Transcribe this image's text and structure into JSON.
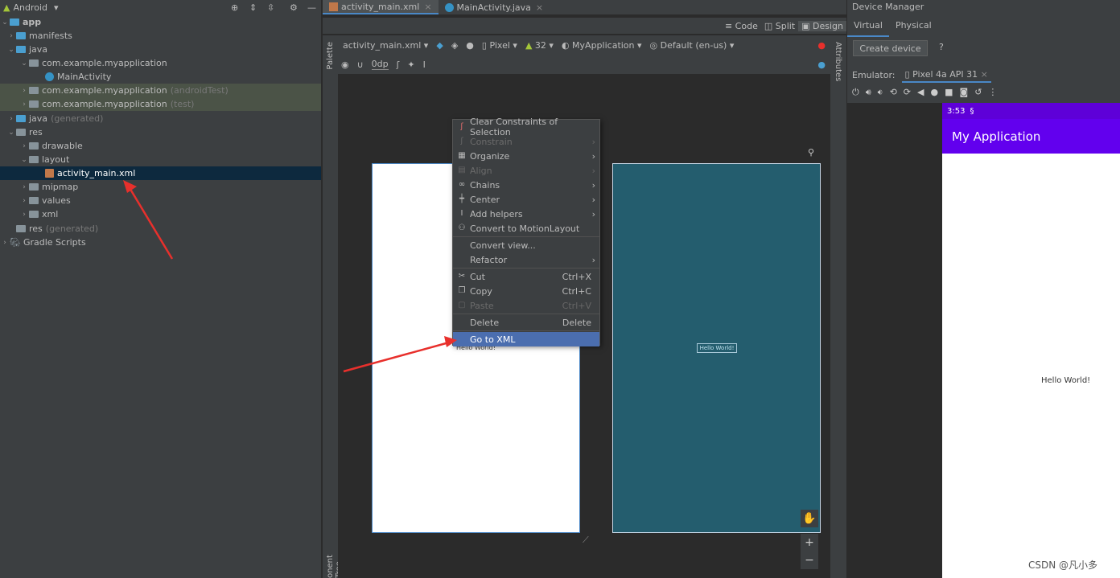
{
  "project": {
    "header": "Android",
    "tree": [
      {
        "label": "app",
        "note": ""
      },
      {
        "label": "manifests",
        "note": ""
      },
      {
        "label": "java",
        "note": ""
      },
      {
        "label": "com.example.myapplication",
        "note": ""
      },
      {
        "label": "MainActivity",
        "note": ""
      },
      {
        "label": "com.example.myapplication",
        "note": "(androidTest)"
      },
      {
        "label": "com.example.myapplication",
        "note": "(test)"
      },
      {
        "label": "java",
        "note": "(generated)"
      },
      {
        "label": "res",
        "note": ""
      },
      {
        "label": "drawable",
        "note": ""
      },
      {
        "label": "layout",
        "note": ""
      },
      {
        "label": "activity_main.xml",
        "note": ""
      },
      {
        "label": "mipmap",
        "note": ""
      },
      {
        "label": "values",
        "note": ""
      },
      {
        "label": "xml",
        "note": ""
      },
      {
        "label": "res",
        "note": "(generated)"
      },
      {
        "label": "Gradle Scripts",
        "note": ""
      }
    ]
  },
  "editor": {
    "tabs": [
      "activity_main.xml",
      "MainActivity.java"
    ],
    "modes": [
      "Code",
      "Split",
      "Design"
    ],
    "toolbar": {
      "file": "activity_main.xml",
      "device": "Pixel",
      "api": "32",
      "theme": "MyApplication",
      "locale": "Default (en-us)",
      "margin": "0dp"
    },
    "palette_label": "Palette",
    "attributes_label": "Attributes",
    "component_tree_label": "onent Tree",
    "hello_text": "Hello World!"
  },
  "context_menu": {
    "items": [
      {
        "label": "Clear Constraints of Selection",
        "shortcut": "",
        "sub": false,
        "disabled": false
      },
      {
        "label": "Constrain",
        "shortcut": "",
        "sub": true,
        "disabled": true
      },
      {
        "label": "Organize",
        "shortcut": "",
        "sub": true,
        "disabled": false
      },
      {
        "label": "Align",
        "shortcut": "",
        "sub": true,
        "disabled": true
      },
      {
        "label": "Chains",
        "shortcut": "",
        "sub": true,
        "disabled": false
      },
      {
        "label": "Center",
        "shortcut": "",
        "sub": true,
        "disabled": false
      },
      {
        "label": "Add helpers",
        "shortcut": "",
        "sub": true,
        "disabled": false
      },
      {
        "label": "Convert to MotionLayout",
        "shortcut": "",
        "sub": false,
        "disabled": false
      },
      {
        "label": "Convert view...",
        "shortcut": "",
        "sub": false,
        "disabled": false
      },
      {
        "label": "Refactor",
        "shortcut": "",
        "sub": true,
        "disabled": false
      },
      {
        "label": "Cut",
        "shortcut": "Ctrl+X",
        "sub": false,
        "disabled": false
      },
      {
        "label": "Copy",
        "shortcut": "Ctrl+C",
        "sub": false,
        "disabled": false
      },
      {
        "label": "Paste",
        "shortcut": "Ctrl+V",
        "sub": false,
        "disabled": true
      },
      {
        "label": "Delete",
        "shortcut": "Delete",
        "sub": false,
        "disabled": false
      },
      {
        "label": "Go to XML",
        "shortcut": "",
        "sub": false,
        "disabled": false
      }
    ]
  },
  "device_manager": {
    "title": "Device Manager",
    "tabs": [
      "Virtual",
      "Physical"
    ],
    "create_button": "Create device",
    "help": "?",
    "emulator_label": "Emulator:",
    "emulator_tab": "Pixel 4a API 31",
    "status_time": "3:53",
    "app_title": "My Application",
    "hello_text": "Hello World!"
  },
  "watermark": "CSDN @凡小多",
  "colors": {
    "accent": "#4b6eaf",
    "appbar": "#6200ee",
    "blueprint": "#245d6e",
    "annotation_arrow": "#e8302c"
  }
}
